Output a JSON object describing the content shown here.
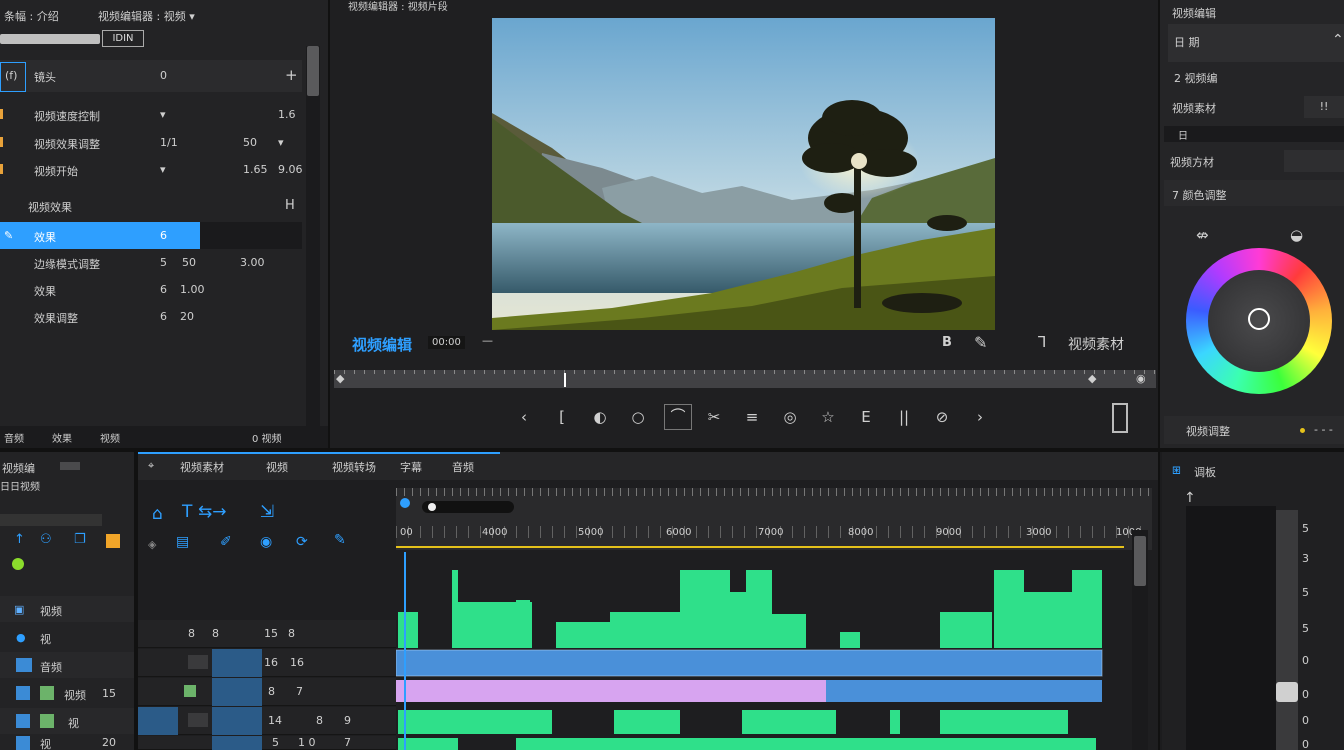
{
  "menu": {
    "item1": "条幅 : 介绍",
    "item2": "视频编辑器 : 视频 ▾",
    "badge": "IDIN"
  },
  "left_panel": {
    "header_label": "(f)",
    "header_name": "镜头",
    "header_value": "0",
    "header_add": "+",
    "rows": [
      {
        "name": "视频速度控制",
        "v1": "▾",
        "v2": "",
        "v3": "1.6"
      },
      {
        "name": "视频效果调整",
        "v1": "1/1",
        "v2": "50",
        "v3": "▾"
      },
      {
        "name": "视频开始",
        "v1": "▾",
        "v2": "1.65",
        "v3": "9.06"
      },
      {
        "name": "视频效果",
        "v1": "",
        "v2": "",
        "v3": "H"
      },
      {
        "name": "效果",
        "v1": "6",
        "v2": "",
        "v3": ""
      },
      {
        "name": "边缘模式调整",
        "v1": "5",
        "v2": "50",
        "v3": "3.00"
      },
      {
        "name": "效果",
        "v1": "6",
        "v2": "1.00",
        "v3": ""
      },
      {
        "name": "效果调整",
        "v1": "6",
        "v2": "20",
        "v3": ""
      }
    ],
    "footer": [
      "音频",
      "效果",
      "视频",
      "0 视频"
    ]
  },
  "viewer": {
    "top_label": "视频编辑器 : 视频片段",
    "title": "视频编辑",
    "timecode": "00:00",
    "right_label": "视频素材",
    "b_label": "B",
    "controls": [
      "‹",
      "[",
      "◐",
      "○",
      "⌒",
      "✂",
      "≡",
      "◎",
      "☆",
      "E",
      "||",
      "⊘",
      "›"
    ],
    "progress_marker": 0.28
  },
  "right_panel": {
    "title": "视频编辑",
    "field1": "日 期",
    "field2": "2 视频编",
    "field3_label": "视频素材",
    "field3_value": "!!",
    "field4": "日",
    "field5_label": "视频方材",
    "field6": "7 颜色调整",
    "footer": "视频调整"
  },
  "left_bottom": {
    "title": "视频编",
    "subtitle": "日日视频",
    "items": [
      {
        "label": "视频"
      },
      {
        "label": "视"
      },
      {
        "label": "音频"
      },
      {
        "label": "视频",
        "value": "15"
      },
      {
        "label": "视"
      },
      {
        "label": "视",
        "value": "20"
      }
    ]
  },
  "timeline": {
    "tabs": [
      "视频素材",
      "视频",
      "视频转场",
      "字幕",
      "音频"
    ],
    "ruler": [
      "00",
      "4000",
      "5000",
      "6000",
      "7000",
      "8000",
      "9000",
      "3000",
      "1000"
    ],
    "track_values": [
      {
        "a": "8",
        "b": "8",
        "c": "15",
        "d": "8"
      },
      {
        "a": "",
        "b": "",
        "c": "16",
        "d": "16"
      },
      {
        "a": "",
        "b": "",
        "c": "8",
        "d": "7"
      },
      {
        "a": "",
        "b": "",
        "c": "14",
        "d": "8",
        "e": "9"
      },
      {
        "a": "",
        "b": "",
        "c": "5",
        "d": "1 0",
        "e": "7"
      }
    ]
  },
  "audio_mixer": {
    "title": "调板",
    "levels": [
      "5",
      "3",
      "5",
      "5",
      "0",
      "0",
      "0",
      "0"
    ]
  },
  "colors": {
    "accent": "#2e9fff",
    "clip_green": "#2fe08a",
    "clip_blue": "#4a90d9",
    "clip_pink": "#d7a4f0",
    "playhead": "#2e9fff",
    "ruler_yellow": "#e5c21b"
  }
}
